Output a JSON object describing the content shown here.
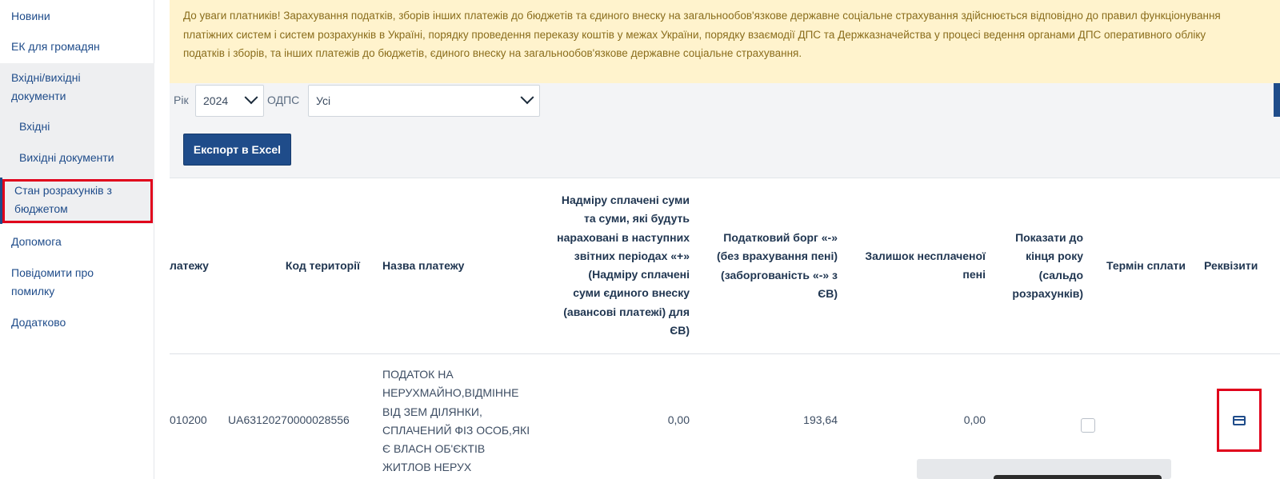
{
  "sidebar": {
    "items": [
      {
        "label": "Новини"
      },
      {
        "label": "ЕК для громадян"
      },
      {
        "label_line1": "Вхідні/вихідні",
        "label_line2": "документи"
      },
      {
        "label": "Вхідні"
      },
      {
        "label": "Вихідні документи"
      },
      {
        "label_line1": "Стан розрахунків з",
        "label_line2": "бюджетом"
      },
      {
        "label": "Допомога"
      },
      {
        "label_line1": "Повідомити про",
        "label_line2": "помилку"
      },
      {
        "label": "Додатково"
      }
    ]
  },
  "notice": {
    "line1": "До уваги платників! Зарахування податків, зборів інших платежів до бюджетів та єдиного внеску на загальнообов'язкове державне соціальне страхування здійснюється відповідно до правил функціонування",
    "line2": "платіжних систем і систем розрахунків в Україні, порядку проведення переказу коштів у межах України, порядку взаємодії ДПС та Держказначейства у процесі ведення органами ДПС оперативного обліку",
    "line3": "податків і зборів, та інших платежів до бюджетів, єдиного внеску на загальнообов'язкове державне соціальне страхування."
  },
  "filters": {
    "year_label": "Рік",
    "year_value": "2024",
    "odps_label": "ОДПС",
    "odps_value": "Усі"
  },
  "toolbar": {
    "export_label": "Експорт в Excel"
  },
  "table": {
    "headers": {
      "payment_code": "латежу",
      "territory_code": "Код території",
      "payment_name": "Назва платежу",
      "overpaid": [
        "Надміру сплачені суми",
        "та суми, які будуть",
        "нараховані в наступних",
        "звітних періодах «+»",
        "(Надміру сплачені",
        "суми єдиного внеску",
        "(авансові платежі) для",
        "ЄВ)"
      ],
      "tax_debt": [
        "Податковий борг «-»",
        "(без врахування пені)",
        "(заборгованість «-» з",
        "ЄВ)"
      ],
      "penalty": [
        "Залишок несплаченої",
        "пені"
      ],
      "show_year_end": [
        "Показати до",
        "кінця року",
        "(сальдо",
        "розрахунків)"
      ],
      "due_date": "Термін сплати",
      "requisites": "Реквізити"
    },
    "rows": [
      {
        "payment_code": "010200",
        "territory_code": "UA63120270000028556",
        "payment_name": [
          "ПОДАТОК НА",
          "НЕРУХМАЙНО,ВІДМІННЕ",
          "ВІД ЗЕМ ДІЛЯНКИ,",
          "СПЛАЧЕНИЙ ФІЗ ОСОБ,ЯКІ",
          "Є ВЛАСН ОБ'ЄКТІВ",
          "ЖИТЛОВ НЕРУХ"
        ],
        "overpaid": "0,00",
        "tax_debt": "193,64",
        "penalty": "0,00",
        "show_year_end": false
      }
    ]
  },
  "icons": {
    "requisites": "credit-card-icon",
    "select": "chevron-down-icon"
  },
  "colors": {
    "brand": "#1f4c8a",
    "highlight": "#e0001b",
    "notice_bg": "#fff3cd",
    "notice_text": "#8a6d1c"
  }
}
